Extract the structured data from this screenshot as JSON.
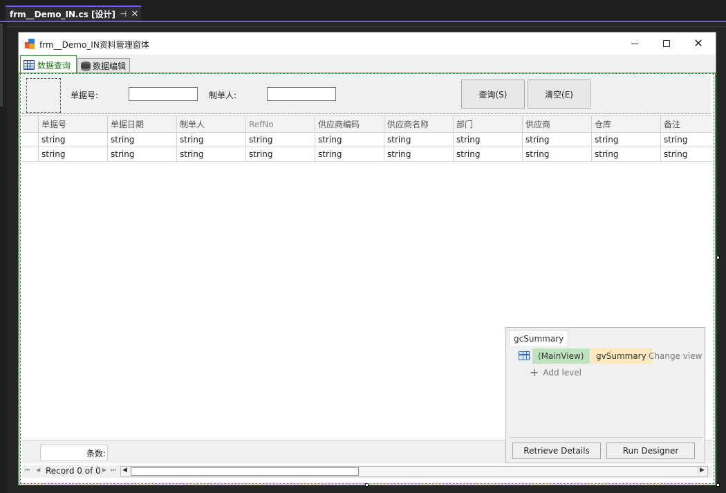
{
  "doc_tab": {
    "title": "frm__Demo_IN.cs [设计]",
    "pin": "⊣",
    "close": "✕"
  },
  "form": {
    "title": "frm__Demo_IN资料管理窗体",
    "close": "✕"
  },
  "tabs": [
    {
      "label": "数据查询",
      "icon": "grid-icon"
    },
    {
      "label": "数据编辑",
      "icon": "database-icon"
    }
  ],
  "search": {
    "bill_no_label": "单据号:",
    "bill_no_value": "",
    "maker_label": "制单人:",
    "maker_value": "",
    "query_button": "查询(S)",
    "clear_button": "清空(E)"
  },
  "grid": {
    "columns": [
      "单据号",
      "单据日期",
      "制单人",
      "RefNo",
      "供应商编码",
      "供应商名称",
      "部门",
      "供应商",
      "仓库",
      "备注"
    ],
    "rows": [
      [
        "string",
        "string",
        "string",
        "string",
        "string",
        "string",
        "string",
        "string",
        "string",
        "string"
      ],
      [
        "string",
        "string",
        "string",
        "string",
        "string",
        "string",
        "string",
        "string",
        "string",
        "string"
      ]
    ]
  },
  "footer": {
    "count_label": "条数:",
    "record_text": "Record 0 of 0"
  },
  "level_designer": {
    "control_name": "gcSummary",
    "main_view": "(MainView)",
    "view_name": "gvSummary",
    "change_view": "Change view",
    "add_level": "Add level",
    "retrieve_details": "Retrieve Details",
    "run_designer": "Run Designer"
  },
  "colors": {
    "accent": "#7160e8",
    "active_tab_text": "#1e7e1e",
    "main_view_chip": "#bfe3bf",
    "view_chip": "#fde9bd"
  }
}
